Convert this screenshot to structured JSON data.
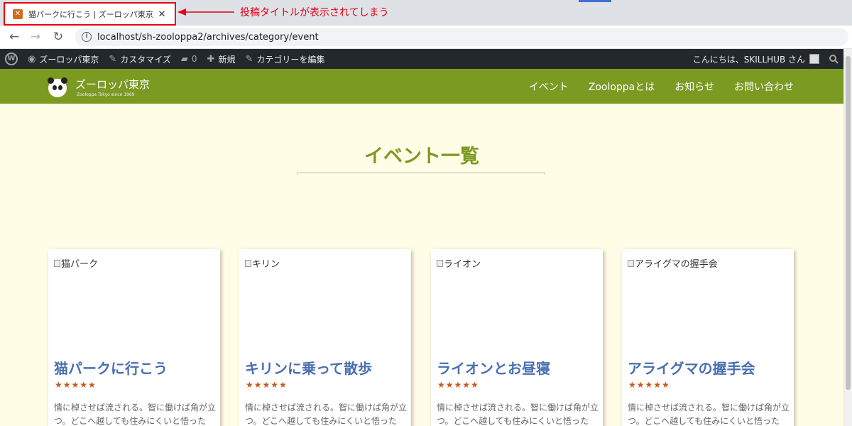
{
  "browser": {
    "tab_title": "猫パークに行こう | ズーロッパ東京",
    "tab_close": "✕",
    "annotation": "投稿タイトルが表示されてしまう",
    "back_icon": "←",
    "forward_icon": "→",
    "reload_icon": "↻",
    "url": "localhost/sh-zooloppa2/archives/category/event",
    "highlight_color": "#e60012"
  },
  "admin_bar": {
    "site_name": "ズーロッパ東京",
    "customize": "カスタマイズ",
    "comments_count": "0",
    "new": "新規",
    "edit_category": "カテゴリーを編集",
    "greeting": "こんにちは、SKILLHUB さん"
  },
  "site": {
    "name": "ズーロッパ東京",
    "tagline": "Zooloppa Tokyo since 1969",
    "accent_color": "#7a9a22",
    "nav": [
      "イベント",
      "Zooloppaとは",
      "お知らせ",
      "お問い合わせ"
    ]
  },
  "page": {
    "title": "イベント一覧"
  },
  "cards": [
    {
      "img_alt": "猫パーク",
      "title": "猫パークに行こう",
      "stars": "★★★★★",
      "text": "情に棹させば流される。智に働けば角が立つ。どこへ越しても住みにくいと悟った"
    },
    {
      "img_alt": "キリン",
      "title": "キリンに乗って散歩",
      "stars": "★★★★★",
      "text": "情に棹させば流される。智に働けば角が立つ。どこへ越しても住みにくいと悟った"
    },
    {
      "img_alt": "ライオン",
      "title": "ライオンとお昼寝",
      "stars": "★★★★★",
      "text": "情に棹させば流される。智に働けば角が立つ。どこへ越しても住みにくいと悟った"
    },
    {
      "img_alt": "アライグマの握手会",
      "title": "アライグマの握手会",
      "stars": "★★★★★",
      "text": "情に棹させば流される。智に働けば角が立つ。どこへ越しても住みにくいと悟った"
    }
  ]
}
